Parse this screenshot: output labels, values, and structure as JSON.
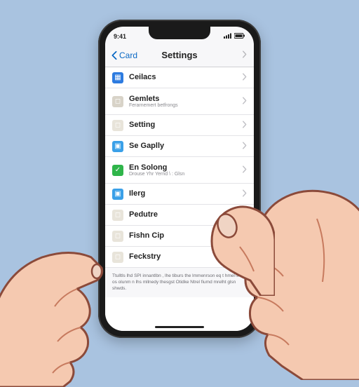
{
  "status": {
    "time": "9:41"
  },
  "navbar": {
    "back_label": "Card",
    "title": "Settings"
  },
  "rows": [
    {
      "label": "Ceilacs",
      "sub": "",
      "icon_color": "#2d7be0",
      "glyph": "▦"
    },
    {
      "label": "Gemlets",
      "sub": "Ferarnemert betfrongs",
      "icon_color": "#d8d3c8",
      "glyph": "◻"
    },
    {
      "label": "Setting",
      "sub": "",
      "icon_color": "#e8e4da",
      "glyph": "◻"
    },
    {
      "label": "Se Gaplly",
      "sub": "",
      "icon_color": "#3aa0e8",
      "glyph": "▣"
    },
    {
      "label": "En Solong",
      "sub": "Drouse Yhr Yernd \\ : Glsn",
      "icon_color": "#2fb54a",
      "glyph": "✓"
    },
    {
      "label": "Ilerg",
      "sub": "",
      "icon_color": "#3aa0e8",
      "glyph": "▣"
    },
    {
      "label": "Pedutre",
      "sub": "",
      "icon_color": "#e8e4da",
      "glyph": "◻"
    },
    {
      "label": "Fishn Cip",
      "sub": "",
      "icon_color": "#e8e4da",
      "glyph": "◻"
    },
    {
      "label": "Feckstry",
      "sub": "",
      "icon_color": "#e8e4da",
      "glyph": "◻"
    }
  ],
  "footer": "Ttulltls lhd SPI innantlbn , lhe tiburs the lmmenrson eq t hmel-s t'r os olunm n lhs mllnedy thesgst Otidke Ntrel fiumd mrelht glsn shwds."
}
